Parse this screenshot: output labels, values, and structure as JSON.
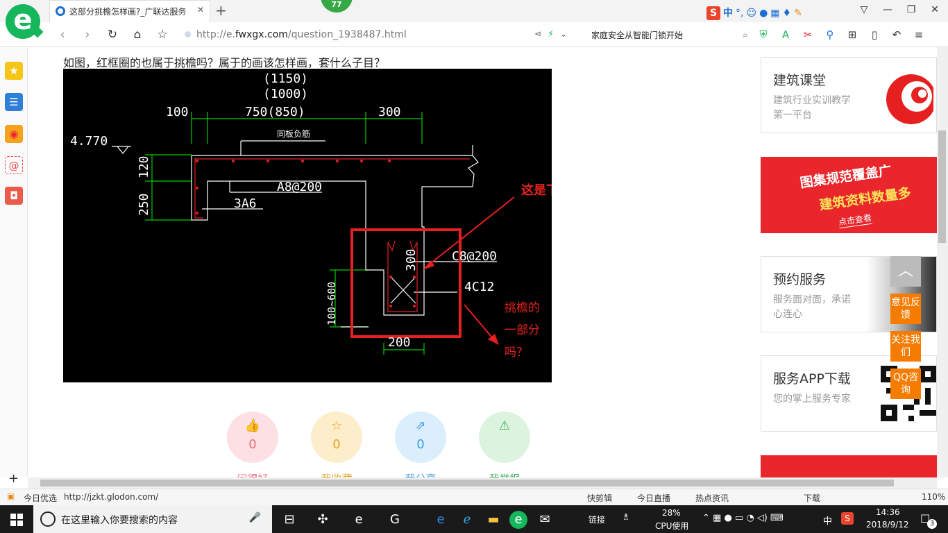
{
  "browser": {
    "tab_title": "这部分挑檐怎样画?_广联达服务",
    "notification_count": "77",
    "url_prefix": "http://e.",
    "url_domain": "fwxgx.com",
    "url_path": "/question_1938487.html",
    "news_text": "家庭安全从智能门锁开始",
    "ime_label": "中",
    "zoom": "110%"
  },
  "question": {
    "text": "如图，红框圈的也属于挑檐吗？属于的画该怎样画，套什么子目？"
  },
  "drawing": {
    "dims_top": [
      "(1150)",
      "(1000)",
      "100",
      "750(850)",
      "300"
    ],
    "elevation": "4.770",
    "slab_label": "同板负筋",
    "left_dims": [
      "120",
      "250"
    ],
    "rebar_labels": [
      "A8@200",
      "3A6",
      "C8@200",
      "4C12"
    ],
    "beam_height": "300",
    "beam_width": "200",
    "drop_range": "100~600",
    "annotation_right": "这是下挂梁，合并梁，套有梁板",
    "annotation_bottom_lines": [
      "挑檐的",
      "一部分",
      "吗？"
    ]
  },
  "actions": [
    {
      "count": "0",
      "label": "问得好",
      "icon": "thumbs-up",
      "bg": "#fde0e3",
      "fg": "#f06c7a"
    },
    {
      "count": "0",
      "label": "我收藏",
      "icon": "star",
      "bg": "#fdeecb",
      "fg": "#e8a31f"
    },
    {
      "count": "0",
      "label": "我分享",
      "icon": "share",
      "bg": "#dbeefc",
      "fg": "#3a9be6"
    },
    {
      "count": "0",
      "label": "我举报",
      "icon": "warning",
      "bg": "#dcf3df",
      "fg": "#3fae55"
    }
  ],
  "cards": [
    {
      "title": "建筑课堂",
      "desc": "建筑行业实训教学第一平台"
    },
    {
      "title": "图集规范覆盖广",
      "subtitle": "建筑资料数量多",
      "button": "点击查看"
    },
    {
      "title": "预约服务",
      "desc": "服务面对面，承诺心连心"
    },
    {
      "title": "服务APP下载",
      "desc": "您的掌上服务专家"
    }
  ],
  "float_buttons": [
    "意见反馈",
    "关注我们",
    "QQ咨询"
  ],
  "statusbar": {
    "today_label": "今日优选",
    "link_url": "http://jzkt.glodon.com/",
    "tools": [
      "快剪辑",
      "今日直播",
      "热点资讯",
      "下载"
    ]
  },
  "taskbar": {
    "search_placeholder": "在这里输入你要搜索的内容",
    "link_label": "链接",
    "cpu_percent": "28%",
    "cpu_label": "CPU使用",
    "ime": "中",
    "time": "14:36",
    "date": "2018/9/12",
    "notifications": "3"
  },
  "colors": {
    "accent_green": "#16b65c",
    "cad_red": "#e62020",
    "cad_green": "#00cc00",
    "float_orange": "#f57c00"
  }
}
